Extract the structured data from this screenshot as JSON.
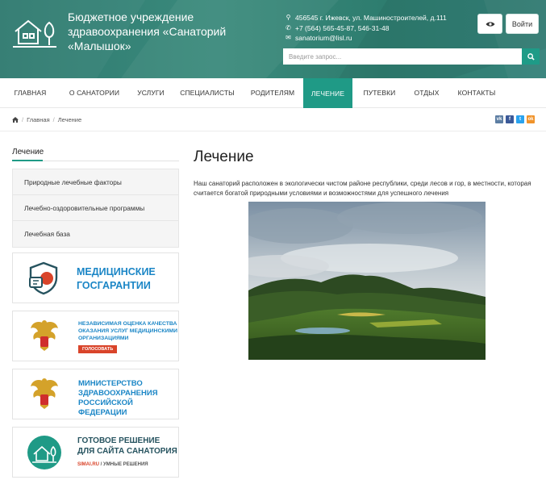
{
  "header": {
    "org_name": "Бюджетное учреждение здравоохранения «Санаторий «Малышок»",
    "address": "456545 г. Ижевск, ул. Машиностроителей, д.111",
    "phone": "+7 (564) 565-45-87, 546-31-48",
    "email": "sanatorium@lisl.ru",
    "login_label": "Войти",
    "search_placeholder": "Введите запрос..."
  },
  "nav": {
    "items": [
      {
        "label": "ГЛАВНАЯ"
      },
      {
        "label": "О САНАТОРИИ"
      },
      {
        "label": "УСЛУГИ"
      },
      {
        "label": "СПЕЦИАЛИСТЫ"
      },
      {
        "label": "РОДИТЕЛЯМ"
      },
      {
        "label": "ЛЕЧЕНИЕ",
        "active": true
      },
      {
        "label": "ПУТЕВКИ"
      },
      {
        "label": "ОТДЫХ"
      },
      {
        "label": "КОНТАКТЫ"
      }
    ]
  },
  "breadcrumb": {
    "items": [
      "Главная",
      "Лечение"
    ]
  },
  "share": [
    {
      "icon": "vk-icon",
      "label": "vk",
      "color": "#5d7ea3"
    },
    {
      "icon": "facebook-icon",
      "label": "f",
      "color": "#3b5998"
    },
    {
      "icon": "twitter-icon",
      "label": "t",
      "color": "#2aa3ef"
    },
    {
      "icon": "odnoklassniki-icon",
      "label": "ok",
      "color": "#f0932b"
    }
  ],
  "sidebar": {
    "title": "Лечение",
    "items": [
      {
        "label": "Природные лечебные факторы"
      },
      {
        "label": "Лечебно-оздоровительные программы"
      },
      {
        "label": "Лечебная база"
      }
    ],
    "banners": {
      "gos": {
        "line1": "МЕДИЦИНСКИЕ",
        "line2": "ГОСГАРАНТИИ"
      },
      "quality": {
        "line1": "НЕЗАВИСИМАЯ ОЦЕНКА КАЧЕСТВА",
        "line2": "ОКАЗАНИЯ УСЛУГ МЕДИЦИНСКИМИ",
        "line3": "ОРГАНИЗАЦИЯМИ",
        "button": "ГОЛОСОВАТЬ"
      },
      "ministry": {
        "line1": "МИНИСТЕРСТВО",
        "line2": "ЗДРАВООХРАНЕНИЯ",
        "line3": "РОССИЙСКОЙ ФЕДЕРАЦИИ"
      },
      "simai": {
        "line1": "ГОТОВОЕ РЕШЕНИЕ",
        "line2": "ДЛЯ САЙТА САНАТОРИЯ",
        "brand": "SIMAI.RU",
        "tagline": " / УМНЫЕ РЕШЕНИЯ"
      }
    }
  },
  "content": {
    "title": "Лечение",
    "text": "Наш санаторий расположен в экологически чистом районе республики, среди лесов и гор, в местности, которая считается  богатой природными условиями и возможностями для успешного лечения"
  },
  "colors": {
    "accent": "#1f9a86",
    "header_bg": "#2f7a70",
    "banner_blue": "#1b86c6",
    "banner_dark": "#26535f",
    "vote_red": "#d9442a"
  }
}
